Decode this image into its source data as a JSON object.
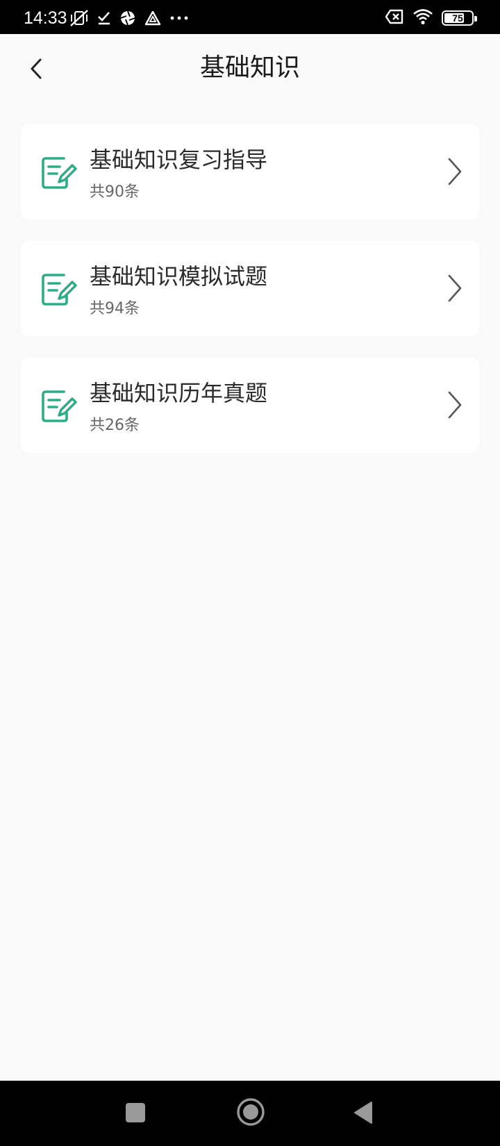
{
  "status_bar": {
    "time": "14:33",
    "left_icons": [
      "mute-vibrate-icon",
      "check-icon",
      "aperture-icon",
      "triangle-app-icon",
      "more-dots-icon"
    ],
    "right_icons": [
      "sim-x-icon",
      "wifi-icon",
      "battery-icon"
    ],
    "battery_level": "75"
  },
  "header": {
    "back_icon": "chevron-left-icon",
    "title": "基础知识"
  },
  "items": [
    {
      "title": "基础知识复习指导",
      "count": "共90条",
      "icon": "edit-document-icon"
    },
    {
      "title": "基础知识模拟试题",
      "count": "共94条",
      "icon": "edit-document-icon"
    },
    {
      "title": "基础知识历年真题",
      "count": "共26条",
      "icon": "edit-document-icon"
    }
  ],
  "nav_bar": {
    "icons": [
      "recents-square-icon",
      "home-circle-icon",
      "back-triangle-icon"
    ]
  },
  "colors": {
    "accent": "#2bae85",
    "background": "#f9f9f9",
    "card": "#ffffff"
  }
}
